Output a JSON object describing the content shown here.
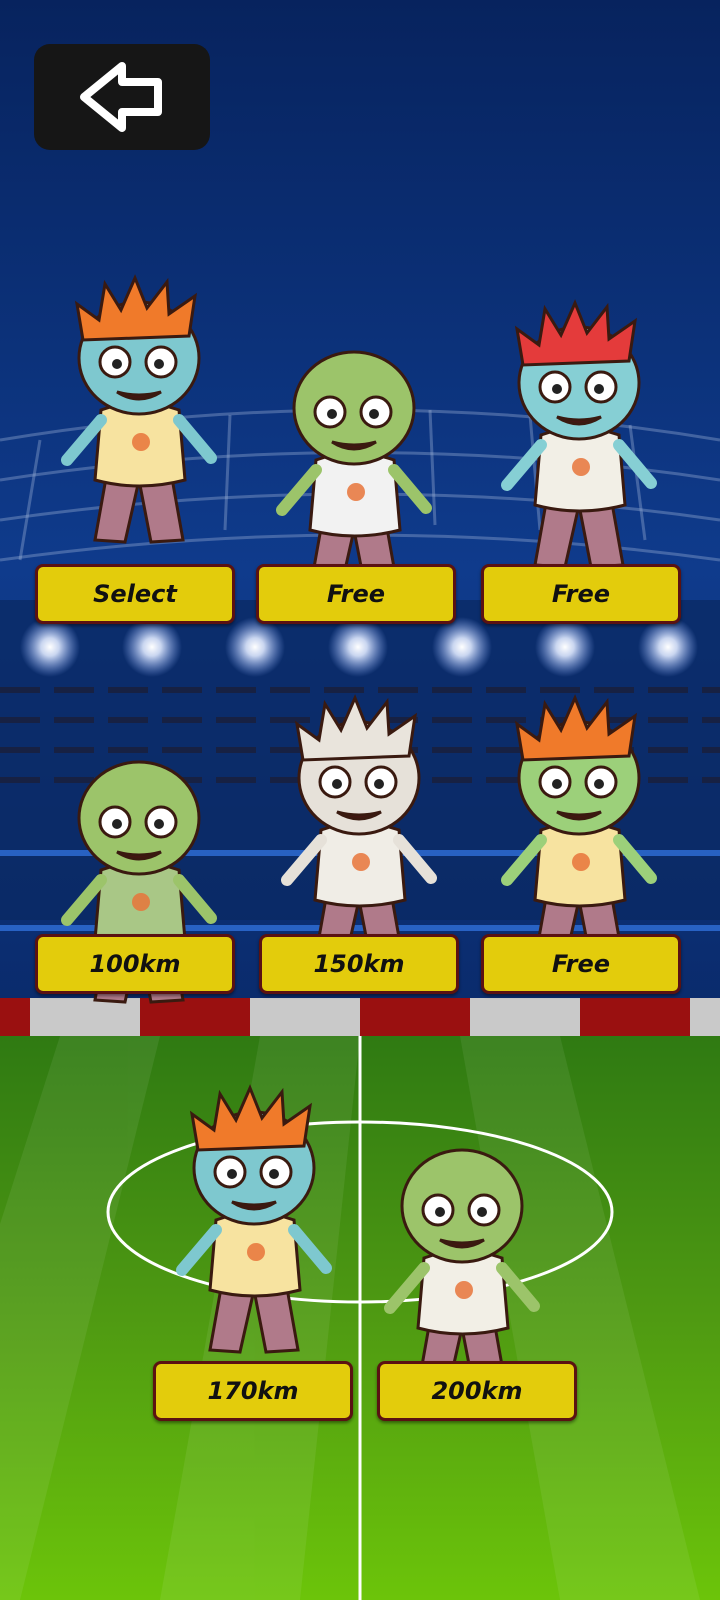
{
  "header": {
    "back_icon": "arrow-left-icon"
  },
  "characters": [
    {
      "button_label": "Select",
      "hair_color": "#f07a2a",
      "skin_color": "#7ec8cf",
      "shirt_color": "#f7e3a0"
    },
    {
      "button_label": "Free",
      "hair_color": "none",
      "skin_color": "#9cc46a",
      "shirt_color": "#f2f2f2"
    },
    {
      "button_label": "Free",
      "hair_color": "#e43b3b",
      "skin_color": "#86cfd4",
      "shirt_color": "#f2efe6"
    },
    {
      "button_label": "100km",
      "hair_color": "none",
      "skin_color": "#9cc46a",
      "shirt_color": "#a9c786"
    },
    {
      "button_label": "150km",
      "hair_color": "#e9e4dc",
      "skin_color": "#e6e1d9",
      "shirt_color": "#f0ede6"
    },
    {
      "button_label": "Free",
      "hair_color": "#f07a2a",
      "skin_color": "#9cd07a",
      "shirt_color": "#f7e3a0"
    },
    {
      "button_label": "170km",
      "hair_color": "#f07a2a",
      "skin_color": "#7ec8cf",
      "shirt_color": "#f7e3a0"
    },
    {
      "button_label": "200km",
      "hair_color": "none",
      "skin_color": "#9cc46a",
      "shirt_color": "#f2efe6"
    }
  ],
  "colors": {
    "button_fill": "#e3cc0c",
    "button_border": "#5a1212",
    "sky_top": "#07235e",
    "pitch_green": "#4f9a12",
    "ad_board_red": "#9a1010"
  }
}
